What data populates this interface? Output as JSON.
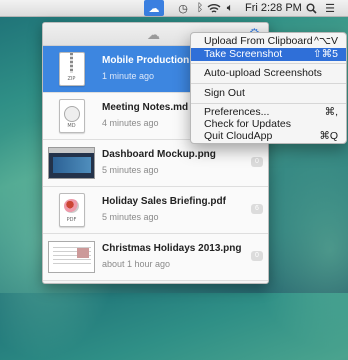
{
  "menubar": {
    "time": "Fri 2:28 PM",
    "icons": [
      "cloudapp-icon",
      "time-machine-icon",
      "bluetooth-icon",
      "wifi-icon",
      "volume-icon",
      "spotlight-icon",
      "notification-list-icon"
    ]
  },
  "files": [
    {
      "name": "Mobile Production Assets",
      "time": "1 minute ago",
      "badge": "",
      "thumb": "zip",
      "tag": "ZIP",
      "selected": true
    },
    {
      "name": "Meeting Notes.md",
      "time": "4 minutes ago",
      "badge": "8",
      "thumb": "md",
      "tag": "MD",
      "selected": false
    },
    {
      "name": "Dashboard Mockup.png",
      "time": "5 minutes ago",
      "badge": "0",
      "thumb": "screenshot",
      "tag": "",
      "selected": false
    },
    {
      "name": "Holiday Sales Briefing.pdf",
      "time": "5 minutes ago",
      "badge": "6",
      "thumb": "pdf",
      "tag": "PDF",
      "selected": false
    },
    {
      "name": "Christmas Holidays 2013.png",
      "time": "about 1 hour ago",
      "badge": "0",
      "thumb": "photo",
      "tag": "",
      "selected": false
    }
  ],
  "menu": {
    "upload_clipboard": {
      "label": "Upload From Clipboard",
      "shortcut": "^⌥V"
    },
    "take_screenshot": {
      "label": "Take Screenshot",
      "shortcut": "⇧⌘5"
    },
    "auto_upload": {
      "label": "Auto-upload Screenshots",
      "shortcut": ""
    },
    "sign_out": {
      "label": "Sign Out",
      "shortcut": ""
    },
    "preferences": {
      "label": "Preferences...",
      "shortcut": "⌘,"
    },
    "check_updates": {
      "label": "Check for Updates",
      "shortcut": ""
    },
    "quit": {
      "label": "Quit CloudApp",
      "shortcut": "⌘Q"
    }
  },
  "colors": {
    "accent": "#3d86e0",
    "menu_highlight": "#2f6fd8"
  }
}
